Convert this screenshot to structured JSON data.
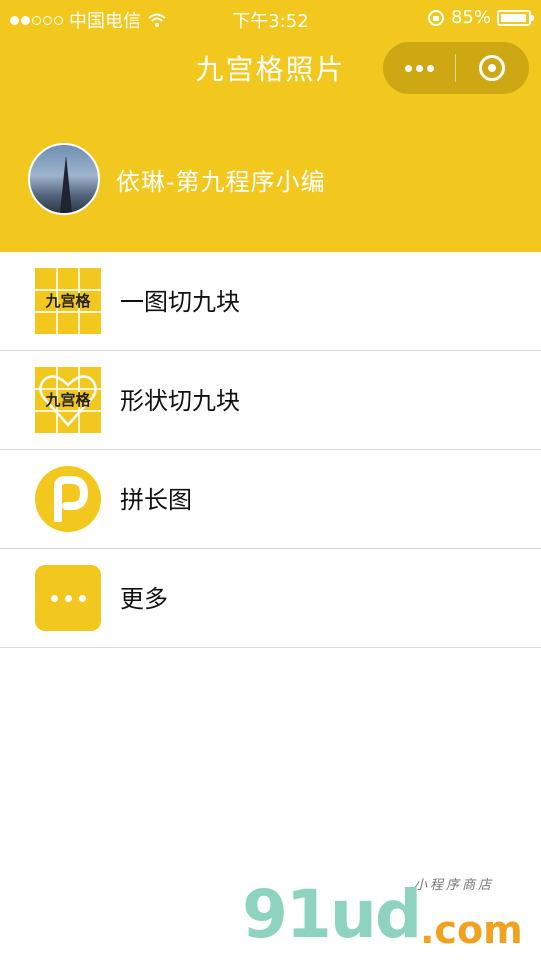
{
  "status_bar": {
    "carrier": "中国电信",
    "time": "下午3:52",
    "battery": "85%",
    "battery_level": 0.85,
    "signal_dots_filled": 2,
    "signal_dots_total": 5
  },
  "nav": {
    "title": "九宫格照片"
  },
  "profile": {
    "name": "依琳-第九程序小编"
  },
  "menu": {
    "items": [
      {
        "label": "一图切九块",
        "icon": "grid-nine-icon",
        "icon_text": "九宫格"
      },
      {
        "label": "形状切九块",
        "icon": "heart-grid-icon",
        "icon_text": "九宫格"
      },
      {
        "label": "拼长图",
        "icon": "p-circle-icon",
        "icon_text": "p"
      },
      {
        "label": "更多",
        "icon": "more-dots-icon"
      }
    ]
  },
  "watermark": {
    "main": "91ud",
    "suffix": ".com",
    "tagline": "小程序商店"
  },
  "colors": {
    "accent": "#f2c81e",
    "divider": "#d9d9d9",
    "text": "#111111"
  }
}
